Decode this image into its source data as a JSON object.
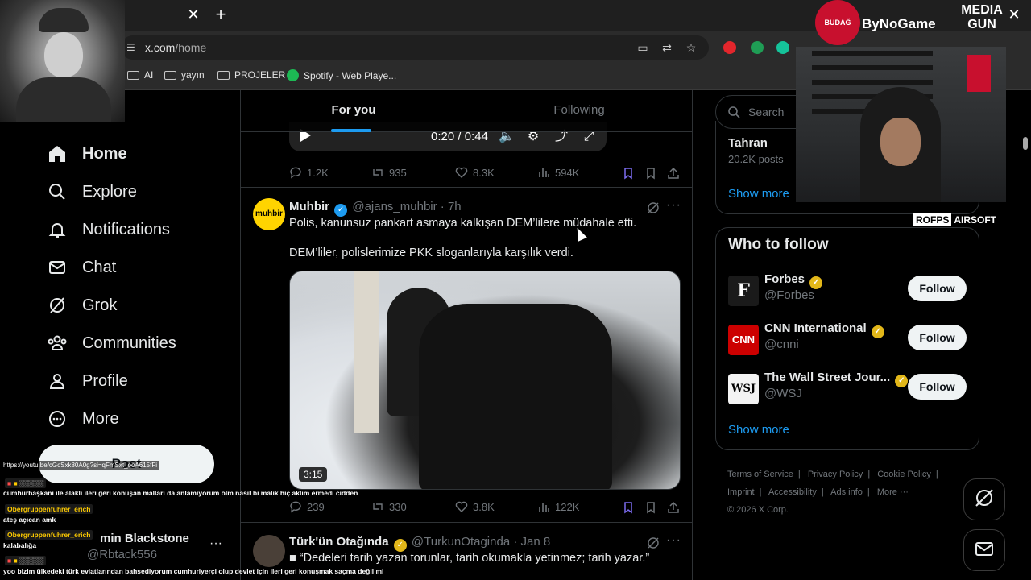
{
  "browser": {
    "url_host": "x.com",
    "url_path": "/home",
    "bookmarks": [
      "AI",
      "yayın",
      "PROJELER",
      "Spotify - Web Playe..."
    ]
  },
  "nav": {
    "items": [
      {
        "label": "Home",
        "icon": "home-icon"
      },
      {
        "label": "Explore",
        "icon": "search-icon"
      },
      {
        "label": "Notifications",
        "icon": "bell-icon"
      },
      {
        "label": "Chat",
        "icon": "mail-icon"
      },
      {
        "label": "Grok",
        "icon": "grok-icon"
      },
      {
        "label": "Communities",
        "icon": "people-icon"
      },
      {
        "label": "Profile",
        "icon": "person-icon"
      },
      {
        "label": "More",
        "icon": "more-circle-icon"
      }
    ],
    "post_label": "Post",
    "profile_name": "min Blackstone",
    "profile_handle": "@Rbtack556"
  },
  "timeline": {
    "tabs": [
      "For you",
      "Following"
    ],
    "video": {
      "time": "0:20 / 0:44"
    },
    "prev_tweet_actions": {
      "replies": "1.2K",
      "reposts": "935",
      "likes": "8.3K",
      "views": "594K"
    },
    "tweet": {
      "name": "Muhbir",
      "handle": "@ajans_muhbir",
      "time": "7h",
      "avatar_text": "muhbir",
      "text1": "Polis, kanunsuz pankart asmaya kalkışan DEM’lilere müdahale etti.",
      "text2": "DEM’liler, polislerimize PKK sloganlarıyla karşılık verdi.",
      "duration": "3:15",
      "actions": {
        "replies": "239",
        "reposts": "330",
        "likes": "3.8K",
        "views": "122K"
      }
    },
    "next_tweet": {
      "name": "Türk'ün Otağında",
      "handle": "@TurkunOtaginda",
      "time": "Jan 8",
      "text": "■ “Dedeleri tarih yazan torunlar, tarih okumakla yetinmez; tarih yazar.”"
    }
  },
  "sidebar": {
    "search_placeholder": "Search",
    "trend": {
      "name": "Tahran",
      "count": "20.2K posts"
    },
    "show_more": "Show more",
    "who_to_follow": "Who to follow",
    "accounts": [
      {
        "name": "Forbes",
        "handle": "@Forbes",
        "avatar": "F",
        "color": "#1a1a1a"
      },
      {
        "name": "CNN International",
        "handle": "@cnni",
        "avatar": "CNN",
        "color": "#cc0000"
      },
      {
        "name": "The Wall Street Jour...",
        "handle": "@WSJ",
        "avatar": "WSJ",
        "color": "#f3f3f3"
      }
    ],
    "follow_label": "Follow",
    "footer": [
      "Terms of Service",
      "|",
      "Privacy Policy",
      "|",
      "Cookie Policy",
      "|",
      "Imprint",
      "|",
      "Accessibility",
      "|",
      "Ads info",
      "|",
      "More ···",
      "© 2026 X Corp."
    ]
  },
  "overlay": {
    "logo1": "BUDAĞ",
    "logo2": "ByNoGame",
    "logo3": "MEDIA GUN",
    "rofps": "ROFPS",
    "airsoft": "AIRSOFT",
    "link": "https://youtu.be/cGcSxk80A0g?si=qFmSxt_ooA615fFi",
    "chat": [
      {
        "type": "line",
        "text": "cumhurbaşkanı ile alaklı ileri geri konuşan malları da anlamıyorum olm nasıl bi malık hiç aklım ermedi cidden"
      },
      {
        "type": "user",
        "text": "Obergruppenfuhrer_erich"
      },
      {
        "type": "line",
        "text": "ateş açıcan amk"
      },
      {
        "type": "user",
        "text": "Obergruppenfuhrer_erich"
      },
      {
        "type": "line",
        "text": "kalabalığa"
      },
      {
        "type": "line",
        "text": "yoo bizim ülkedeki türk evlatlarından bahsediyorum cumhuriyerçi olup devlet için ileri geri konuşmak saçma değil mi"
      }
    ]
  }
}
